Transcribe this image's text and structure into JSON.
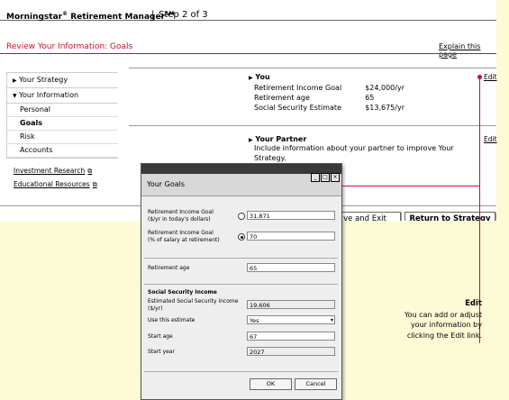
{
  "header": {
    "app_name": "Morningstar",
    "app_reg": "®",
    "app_product": " Retirement Manager",
    "app_sm": "SM",
    "separator": "|",
    "step": "Step 2 of 3"
  },
  "page": {
    "title": "Review Your Information: Goals",
    "explain_link": "Explain this page"
  },
  "sidebar": {
    "items": [
      {
        "label": "Your Strategy",
        "icon": "triangle-right-icon"
      },
      {
        "label": "Your Information",
        "icon": "triangle-down-icon"
      }
    ],
    "subitems": [
      "Personal",
      "Goals",
      "Risk",
      "Accounts"
    ],
    "active_subitem": "Goals",
    "links": [
      "Investment Research",
      "Educational Resources"
    ]
  },
  "you_section": {
    "heading": "You",
    "edit_label": "Edit",
    "rows": [
      {
        "label": "Retirement Income Goal",
        "value": "$24,000/yr"
      },
      {
        "label": "Retirement age",
        "value": "65"
      },
      {
        "label": "Social Security Estimate",
        "value": "$13,675/yr"
      }
    ]
  },
  "partner_section": {
    "heading": "Your Partner",
    "edit_label": "Edit",
    "text": "Include information about your partner to improve Your Strategy."
  },
  "buttons": {
    "save_exit": "ve and Exit",
    "return_strategy": "Return to Strategy"
  },
  "dialog": {
    "title": "Your Goals",
    "income_goal_dollars_label_1": "Retirement Income Goal",
    "income_goal_dollars_label_2": "($/yr in today's dollars)",
    "income_goal_dollars_value": "31,871",
    "income_goal_percent_label_1": "Retirement Income Goal",
    "income_goal_percent_label_2": "(% of salary at retirement)",
    "income_goal_percent_value": "70",
    "retirement_age_label": "Retirement age",
    "retirement_age_value": "65",
    "ss_section": "Social Security Income",
    "ss_estimate_label_1": "Estimated Social Security income",
    "ss_estimate_label_2": "($/yr)",
    "ss_estimate_value": "19,606",
    "use_estimate_label": "Use this estimate",
    "use_estimate_value": "Yes",
    "start_age_label": "Start age",
    "start_age_value": "67",
    "start_year_label": "Start year",
    "start_year_value": "2027",
    "ok_label": "OK",
    "cancel_label": "Cancel",
    "selected_radio": "percent"
  },
  "callout": {
    "heading": "Edit",
    "lines": [
      "You can add or adjust",
      "your information by",
      "clicking the Edit link."
    ]
  },
  "colors": {
    "accent": "#c8102e",
    "background": "#fdfbd6"
  }
}
